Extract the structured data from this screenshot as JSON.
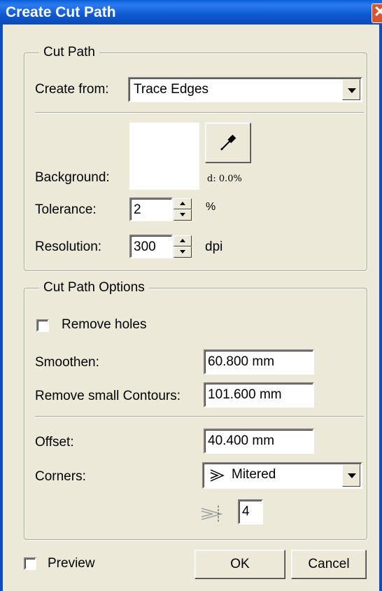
{
  "window": {
    "title": "Create Cut Path"
  },
  "cut_path": {
    "group_label": "Cut Path",
    "create_from_label": "Create from:",
    "create_from_value": "Trace Edges",
    "background_label": "Background:",
    "delta_text": "d: 0.0%",
    "tolerance_label": "Tolerance:",
    "tolerance_value": "2",
    "tolerance_unit": "%",
    "resolution_label": "Resolution:",
    "resolution_value": "300",
    "resolution_unit": "dpi"
  },
  "options": {
    "group_label": "Cut Path Options",
    "remove_holes_label": "Remove holes",
    "remove_holes_checked": false,
    "smoothen_label": "Smoothen:",
    "smoothen_value": "60.800 mm",
    "remove_small_label": "Remove small Contours:",
    "remove_small_value": "101.600 mm",
    "offset_label": "Offset:",
    "offset_value": "40.400 mm",
    "corners_label": "Corners:",
    "corners_value": "Mitered",
    "miter_limit_value": "4"
  },
  "footer": {
    "preview_label": "Preview",
    "preview_checked": false,
    "ok_label": "OK",
    "cancel_label": "Cancel"
  },
  "icons": [
    "close-icon",
    "eyedropper-icon",
    "dropdown-arrow-icon",
    "spin-up-icon",
    "spin-down-icon",
    "mitered-corner-icon",
    "miter-limit-icon",
    "checkbox-icon"
  ],
  "colors": {
    "titlebar": "#0a5fd8",
    "dialog_bg": "#ece9d8",
    "close_button": "#d9552d"
  }
}
